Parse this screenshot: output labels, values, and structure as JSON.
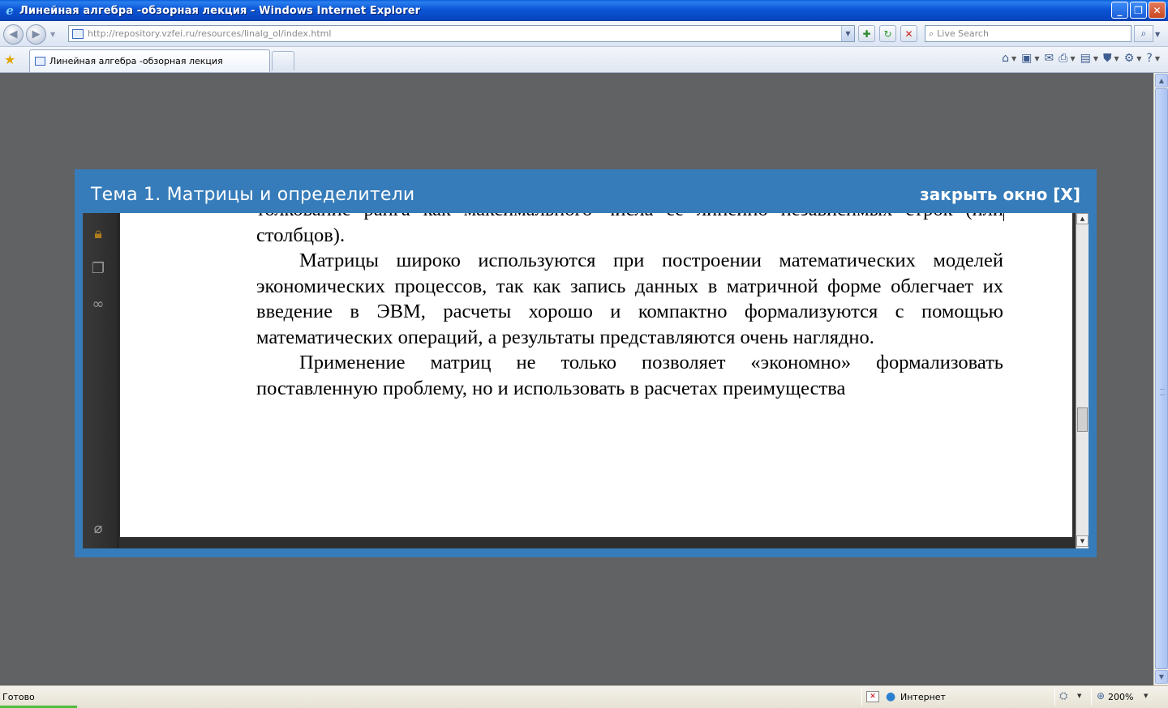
{
  "window": {
    "title": "Линейная алгебра -обзорная лекция - Windows Internet Explorer"
  },
  "address_bar": {
    "url": "http://repository.vzfei.ru/resources/linalg_ol/index.html"
  },
  "search": {
    "placeholder": "Live Search"
  },
  "tabs": [
    {
      "label": "Линейная алгебра -обзорная лекция"
    }
  ],
  "modal": {
    "title": "Тема 1. Матрицы и определители",
    "close_label": "закрыть окно [X]"
  },
  "document": {
    "paragraphs": [
      "толкование ранга как максимального числа ее линейно независимых строк (или столбцов).",
      "Матрицы широко используются при построении математических моделей экономических процессов, так как запись данных в матричной форме облегчает их введение в ЭВМ, расчеты хорошо и компактно формализуются с помощью математических операций, а результаты представляются очень наглядно.",
      "Применение матриц не только позволяет «экономно» формализовать поставленную проблему, но и использовать в расчетах преимущества"
    ]
  },
  "status_bar": {
    "status": "Готово",
    "zone": "Интернет",
    "zoom": "200%"
  }
}
